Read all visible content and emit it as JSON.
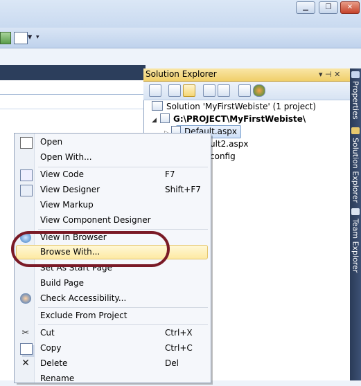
{
  "window_controls": {
    "minimize": "▁",
    "restore": "❐",
    "close": "✕"
  },
  "solution_explorer": {
    "title": "Solution Explorer",
    "title_pin": "▾ ⊣ ✕",
    "tree": {
      "solution": "Solution 'MyFirstWebiste' (1 project)",
      "project": "G:\\PROJECT\\MyFirstWebiste\\",
      "items": [
        "Default.aspx",
        "ult2.aspx",
        "config"
      ]
    }
  },
  "dock_tabs": [
    "Properties",
    "Solution Explorer",
    "Team Explorer"
  ],
  "context_menu": {
    "items": [
      {
        "label": "Open",
        "shortcut": "",
        "icon": "open-file-icon"
      },
      {
        "label": "Open With...",
        "shortcut": ""
      },
      {
        "label": "View Code",
        "shortcut": "F7",
        "icon": "view-code-icon"
      },
      {
        "label": "View Designer",
        "shortcut": "Shift+F7",
        "icon": "view-designer-icon"
      },
      {
        "label": "View Markup",
        "shortcut": ""
      },
      {
        "label": "View Component Designer",
        "shortcut": ""
      },
      {
        "label": "View in Browser",
        "shortcut": "",
        "icon": "browser-icon"
      },
      {
        "label": "Browse With...",
        "shortcut": ""
      },
      {
        "label": "Set As Start Page",
        "shortcut": ""
      },
      {
        "label": "Build Page",
        "shortcut": ""
      },
      {
        "label": "Check Accessibility...",
        "shortcut": "",
        "icon": "accessibility-icon"
      },
      {
        "label": "Exclude From Project",
        "shortcut": ""
      },
      {
        "label": "Cut",
        "shortcut": "Ctrl+X",
        "icon": "scissors-icon"
      },
      {
        "label": "Copy",
        "shortcut": "Ctrl+C",
        "icon": "copy-icon"
      },
      {
        "label": "Delete",
        "shortcut": "Del",
        "icon": "delete-icon"
      },
      {
        "label": "Rename",
        "shortcut": ""
      }
    ]
  },
  "colors": {
    "highlight_ring": "#7a1a26",
    "menu_hover": "#fde9a3"
  }
}
